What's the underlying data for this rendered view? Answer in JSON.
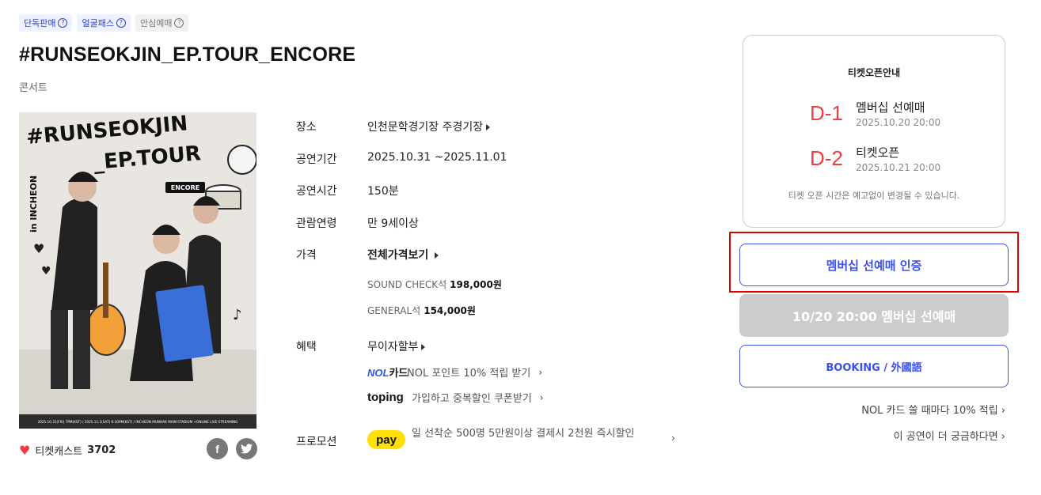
{
  "badges": [
    {
      "label": "단독판매",
      "style": "blue"
    },
    {
      "label": "얼굴패스",
      "style": "blue"
    },
    {
      "label": "안심예매",
      "style": "gray"
    }
  ],
  "title": "#RUNSEOKJIN_EP.TOUR_ENCORE",
  "genre": "콘서트",
  "poster": {
    "title_line1": "#RUNSEOKJIN",
    "title_line2": "_EP.TOUR",
    "location": "in INCHEON",
    "tag": "ENCORE",
    "footer": "2025.10.31(FRI) 7PM(KST) / 2025.11.1(SAT) 6:30PM(KST) / INCHEON MUNHAK MAIN STADIUM  +ONLINE LIVE STREAMING"
  },
  "ticketcast": {
    "label": "티켓캐스트",
    "count": "3702",
    "icon": "heart-icon"
  },
  "share": {
    "facebook": "f",
    "twitter_icon": "twitter-bird-icon"
  },
  "info": {
    "venue": {
      "label": "장소",
      "value": "인천문학경기장 주경기장"
    },
    "period": {
      "label": "공연기간",
      "value": "2025.10.31 ~2025.11.01"
    },
    "runtime": {
      "label": "공연시간",
      "value": "150분"
    },
    "age": {
      "label": "관람연령",
      "value": "만 9세이상"
    },
    "price": {
      "label": "가격",
      "link": "전체가격보기",
      "items": [
        {
          "seat": "SOUND CHECK석",
          "price": "198,000원"
        },
        {
          "seat": "GENERAL석",
          "price": "154,000원"
        }
      ]
    },
    "benefit": {
      "label": "혜택",
      "value": "무이자할부",
      "nol_brand": "NOL",
      "nol_suffix": "카드",
      "nol_text": "NOL 포인트 10% 적립 받기",
      "toping_brand": "toping",
      "toping_text": "가입하고 중복할인 쿠폰받기"
    },
    "promotion": {
      "label": "프로모션",
      "brand": "pay",
      "text": "일 선착순 500명 5만원이상 결제시 2천원 즉시할인"
    }
  },
  "open_info": {
    "title": "티켓오픈안내",
    "items": [
      {
        "dday": "D-1",
        "name": "멤버십 선예매",
        "date": "2025.10.20 20:00"
      },
      {
        "dday": "D-2",
        "name": "티켓오픈",
        "date": "2025.10.21 20:00"
      }
    ],
    "note": "티켓 오픈 시간은 예고없이 변경될 수 있습니다."
  },
  "buttons": {
    "verify": "멤버십 선예매 인증",
    "disabled": "10/20 20:00 멤버십 선예매",
    "booking": "BOOKING / 外國語"
  },
  "links": {
    "nol_card": "NOL 카드 쓸 때마다 10% 적립",
    "more": "이 공연이 더 궁금하다면"
  },
  "colors": {
    "accent": "#3b4ff0",
    "dday": "#ef3e42",
    "highlight": "#e00000",
    "kakao": "#ffe000"
  }
}
